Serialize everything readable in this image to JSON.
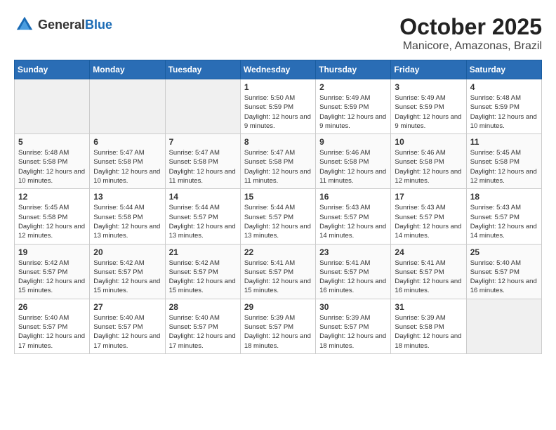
{
  "header": {
    "logo_general": "General",
    "logo_blue": "Blue",
    "month": "October 2025",
    "location": "Manicore, Amazonas, Brazil"
  },
  "days_of_week": [
    "Sunday",
    "Monday",
    "Tuesday",
    "Wednesday",
    "Thursday",
    "Friday",
    "Saturday"
  ],
  "weeks": [
    [
      {
        "day": "",
        "sunrise": "",
        "sunset": "",
        "daylight": ""
      },
      {
        "day": "",
        "sunrise": "",
        "sunset": "",
        "daylight": ""
      },
      {
        "day": "",
        "sunrise": "",
        "sunset": "",
        "daylight": ""
      },
      {
        "day": "1",
        "sunrise": "Sunrise: 5:50 AM",
        "sunset": "Sunset: 5:59 PM",
        "daylight": "Daylight: 12 hours and 9 minutes."
      },
      {
        "day": "2",
        "sunrise": "Sunrise: 5:49 AM",
        "sunset": "Sunset: 5:59 PM",
        "daylight": "Daylight: 12 hours and 9 minutes."
      },
      {
        "day": "3",
        "sunrise": "Sunrise: 5:49 AM",
        "sunset": "Sunset: 5:59 PM",
        "daylight": "Daylight: 12 hours and 9 minutes."
      },
      {
        "day": "4",
        "sunrise": "Sunrise: 5:48 AM",
        "sunset": "Sunset: 5:59 PM",
        "daylight": "Daylight: 12 hours and 10 minutes."
      }
    ],
    [
      {
        "day": "5",
        "sunrise": "Sunrise: 5:48 AM",
        "sunset": "Sunset: 5:58 PM",
        "daylight": "Daylight: 12 hours and 10 minutes."
      },
      {
        "day": "6",
        "sunrise": "Sunrise: 5:47 AM",
        "sunset": "Sunset: 5:58 PM",
        "daylight": "Daylight: 12 hours and 10 minutes."
      },
      {
        "day": "7",
        "sunrise": "Sunrise: 5:47 AM",
        "sunset": "Sunset: 5:58 PM",
        "daylight": "Daylight: 12 hours and 11 minutes."
      },
      {
        "day": "8",
        "sunrise": "Sunrise: 5:47 AM",
        "sunset": "Sunset: 5:58 PM",
        "daylight": "Daylight: 12 hours and 11 minutes."
      },
      {
        "day": "9",
        "sunrise": "Sunrise: 5:46 AM",
        "sunset": "Sunset: 5:58 PM",
        "daylight": "Daylight: 12 hours and 11 minutes."
      },
      {
        "day": "10",
        "sunrise": "Sunrise: 5:46 AM",
        "sunset": "Sunset: 5:58 PM",
        "daylight": "Daylight: 12 hours and 12 minutes."
      },
      {
        "day": "11",
        "sunrise": "Sunrise: 5:45 AM",
        "sunset": "Sunset: 5:58 PM",
        "daylight": "Daylight: 12 hours and 12 minutes."
      }
    ],
    [
      {
        "day": "12",
        "sunrise": "Sunrise: 5:45 AM",
        "sunset": "Sunset: 5:58 PM",
        "daylight": "Daylight: 12 hours and 12 minutes."
      },
      {
        "day": "13",
        "sunrise": "Sunrise: 5:44 AM",
        "sunset": "Sunset: 5:58 PM",
        "daylight": "Daylight: 12 hours and 13 minutes."
      },
      {
        "day": "14",
        "sunrise": "Sunrise: 5:44 AM",
        "sunset": "Sunset: 5:57 PM",
        "daylight": "Daylight: 12 hours and 13 minutes."
      },
      {
        "day": "15",
        "sunrise": "Sunrise: 5:44 AM",
        "sunset": "Sunset: 5:57 PM",
        "daylight": "Daylight: 12 hours and 13 minutes."
      },
      {
        "day": "16",
        "sunrise": "Sunrise: 5:43 AM",
        "sunset": "Sunset: 5:57 PM",
        "daylight": "Daylight: 12 hours and 14 minutes."
      },
      {
        "day": "17",
        "sunrise": "Sunrise: 5:43 AM",
        "sunset": "Sunset: 5:57 PM",
        "daylight": "Daylight: 12 hours and 14 minutes."
      },
      {
        "day": "18",
        "sunrise": "Sunrise: 5:43 AM",
        "sunset": "Sunset: 5:57 PM",
        "daylight": "Daylight: 12 hours and 14 minutes."
      }
    ],
    [
      {
        "day": "19",
        "sunrise": "Sunrise: 5:42 AM",
        "sunset": "Sunset: 5:57 PM",
        "daylight": "Daylight: 12 hours and 15 minutes."
      },
      {
        "day": "20",
        "sunrise": "Sunrise: 5:42 AM",
        "sunset": "Sunset: 5:57 PM",
        "daylight": "Daylight: 12 hours and 15 minutes."
      },
      {
        "day": "21",
        "sunrise": "Sunrise: 5:42 AM",
        "sunset": "Sunset: 5:57 PM",
        "daylight": "Daylight: 12 hours and 15 minutes."
      },
      {
        "day": "22",
        "sunrise": "Sunrise: 5:41 AM",
        "sunset": "Sunset: 5:57 PM",
        "daylight": "Daylight: 12 hours and 15 minutes."
      },
      {
        "day": "23",
        "sunrise": "Sunrise: 5:41 AM",
        "sunset": "Sunset: 5:57 PM",
        "daylight": "Daylight: 12 hours and 16 minutes."
      },
      {
        "day": "24",
        "sunrise": "Sunrise: 5:41 AM",
        "sunset": "Sunset: 5:57 PM",
        "daylight": "Daylight: 12 hours and 16 minutes."
      },
      {
        "day": "25",
        "sunrise": "Sunrise: 5:40 AM",
        "sunset": "Sunset: 5:57 PM",
        "daylight": "Daylight: 12 hours and 16 minutes."
      }
    ],
    [
      {
        "day": "26",
        "sunrise": "Sunrise: 5:40 AM",
        "sunset": "Sunset: 5:57 PM",
        "daylight": "Daylight: 12 hours and 17 minutes."
      },
      {
        "day": "27",
        "sunrise": "Sunrise: 5:40 AM",
        "sunset": "Sunset: 5:57 PM",
        "daylight": "Daylight: 12 hours and 17 minutes."
      },
      {
        "day": "28",
        "sunrise": "Sunrise: 5:40 AM",
        "sunset": "Sunset: 5:57 PM",
        "daylight": "Daylight: 12 hours and 17 minutes."
      },
      {
        "day": "29",
        "sunrise": "Sunrise: 5:39 AM",
        "sunset": "Sunset: 5:57 PM",
        "daylight": "Daylight: 12 hours and 18 minutes."
      },
      {
        "day": "30",
        "sunrise": "Sunrise: 5:39 AM",
        "sunset": "Sunset: 5:57 PM",
        "daylight": "Daylight: 12 hours and 18 minutes."
      },
      {
        "day": "31",
        "sunrise": "Sunrise: 5:39 AM",
        "sunset": "Sunset: 5:58 PM",
        "daylight": "Daylight: 12 hours and 18 minutes."
      },
      {
        "day": "",
        "sunrise": "",
        "sunset": "",
        "daylight": ""
      }
    ]
  ]
}
